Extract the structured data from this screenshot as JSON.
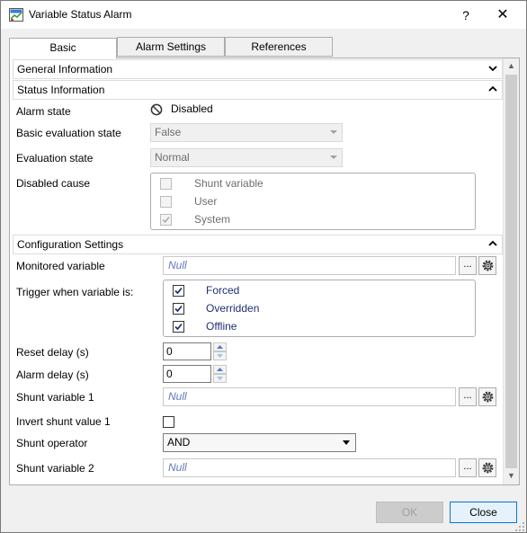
{
  "window": {
    "title": "Variable Status Alarm",
    "help_label": "?",
    "close_label": "✕"
  },
  "tabs": [
    {
      "label": "Basic",
      "active": true
    },
    {
      "label": "Alarm Settings",
      "active": false
    },
    {
      "label": "References",
      "active": false
    }
  ],
  "sections": {
    "general": {
      "title": "General Information",
      "expanded": false
    },
    "status": {
      "title": "Status Information",
      "expanded": true
    },
    "config": {
      "title": "Configuration Settings",
      "expanded": true
    }
  },
  "status": {
    "alarm_state_label": "Alarm state",
    "alarm_state_value": "Disabled",
    "basic_eval_label": "Basic evaluation state",
    "basic_eval_value": "False",
    "eval_label": "Evaluation state",
    "eval_value": "Normal",
    "disabled_cause_label": "Disabled cause",
    "disabled_causes": [
      {
        "label": "Shunt variable",
        "checked": false
      },
      {
        "label": "User",
        "checked": false
      },
      {
        "label": "System",
        "checked": true
      }
    ]
  },
  "config": {
    "monitored_label": "Monitored variable",
    "monitored_value": "Null",
    "trigger_label": "Trigger when variable is:",
    "triggers": [
      {
        "label": "Forced",
        "checked": true
      },
      {
        "label": "Overridden",
        "checked": true
      },
      {
        "label": "Offline",
        "checked": true
      }
    ],
    "reset_delay_label": "Reset delay (s)",
    "reset_delay_value": "0",
    "alarm_delay_label": "Alarm delay (s)",
    "alarm_delay_value": "0",
    "shunt1_label": "Shunt variable 1",
    "shunt1_value": "Null",
    "invert_label": "Invert shunt value 1",
    "invert_checked": false,
    "operator_label": "Shunt operator",
    "operator_value": "AND",
    "shunt2_label": "Shunt variable 2",
    "shunt2_value": "Null",
    "browse_label": "..."
  },
  "footer": {
    "ok_label": "OK",
    "close_label": "Close"
  }
}
